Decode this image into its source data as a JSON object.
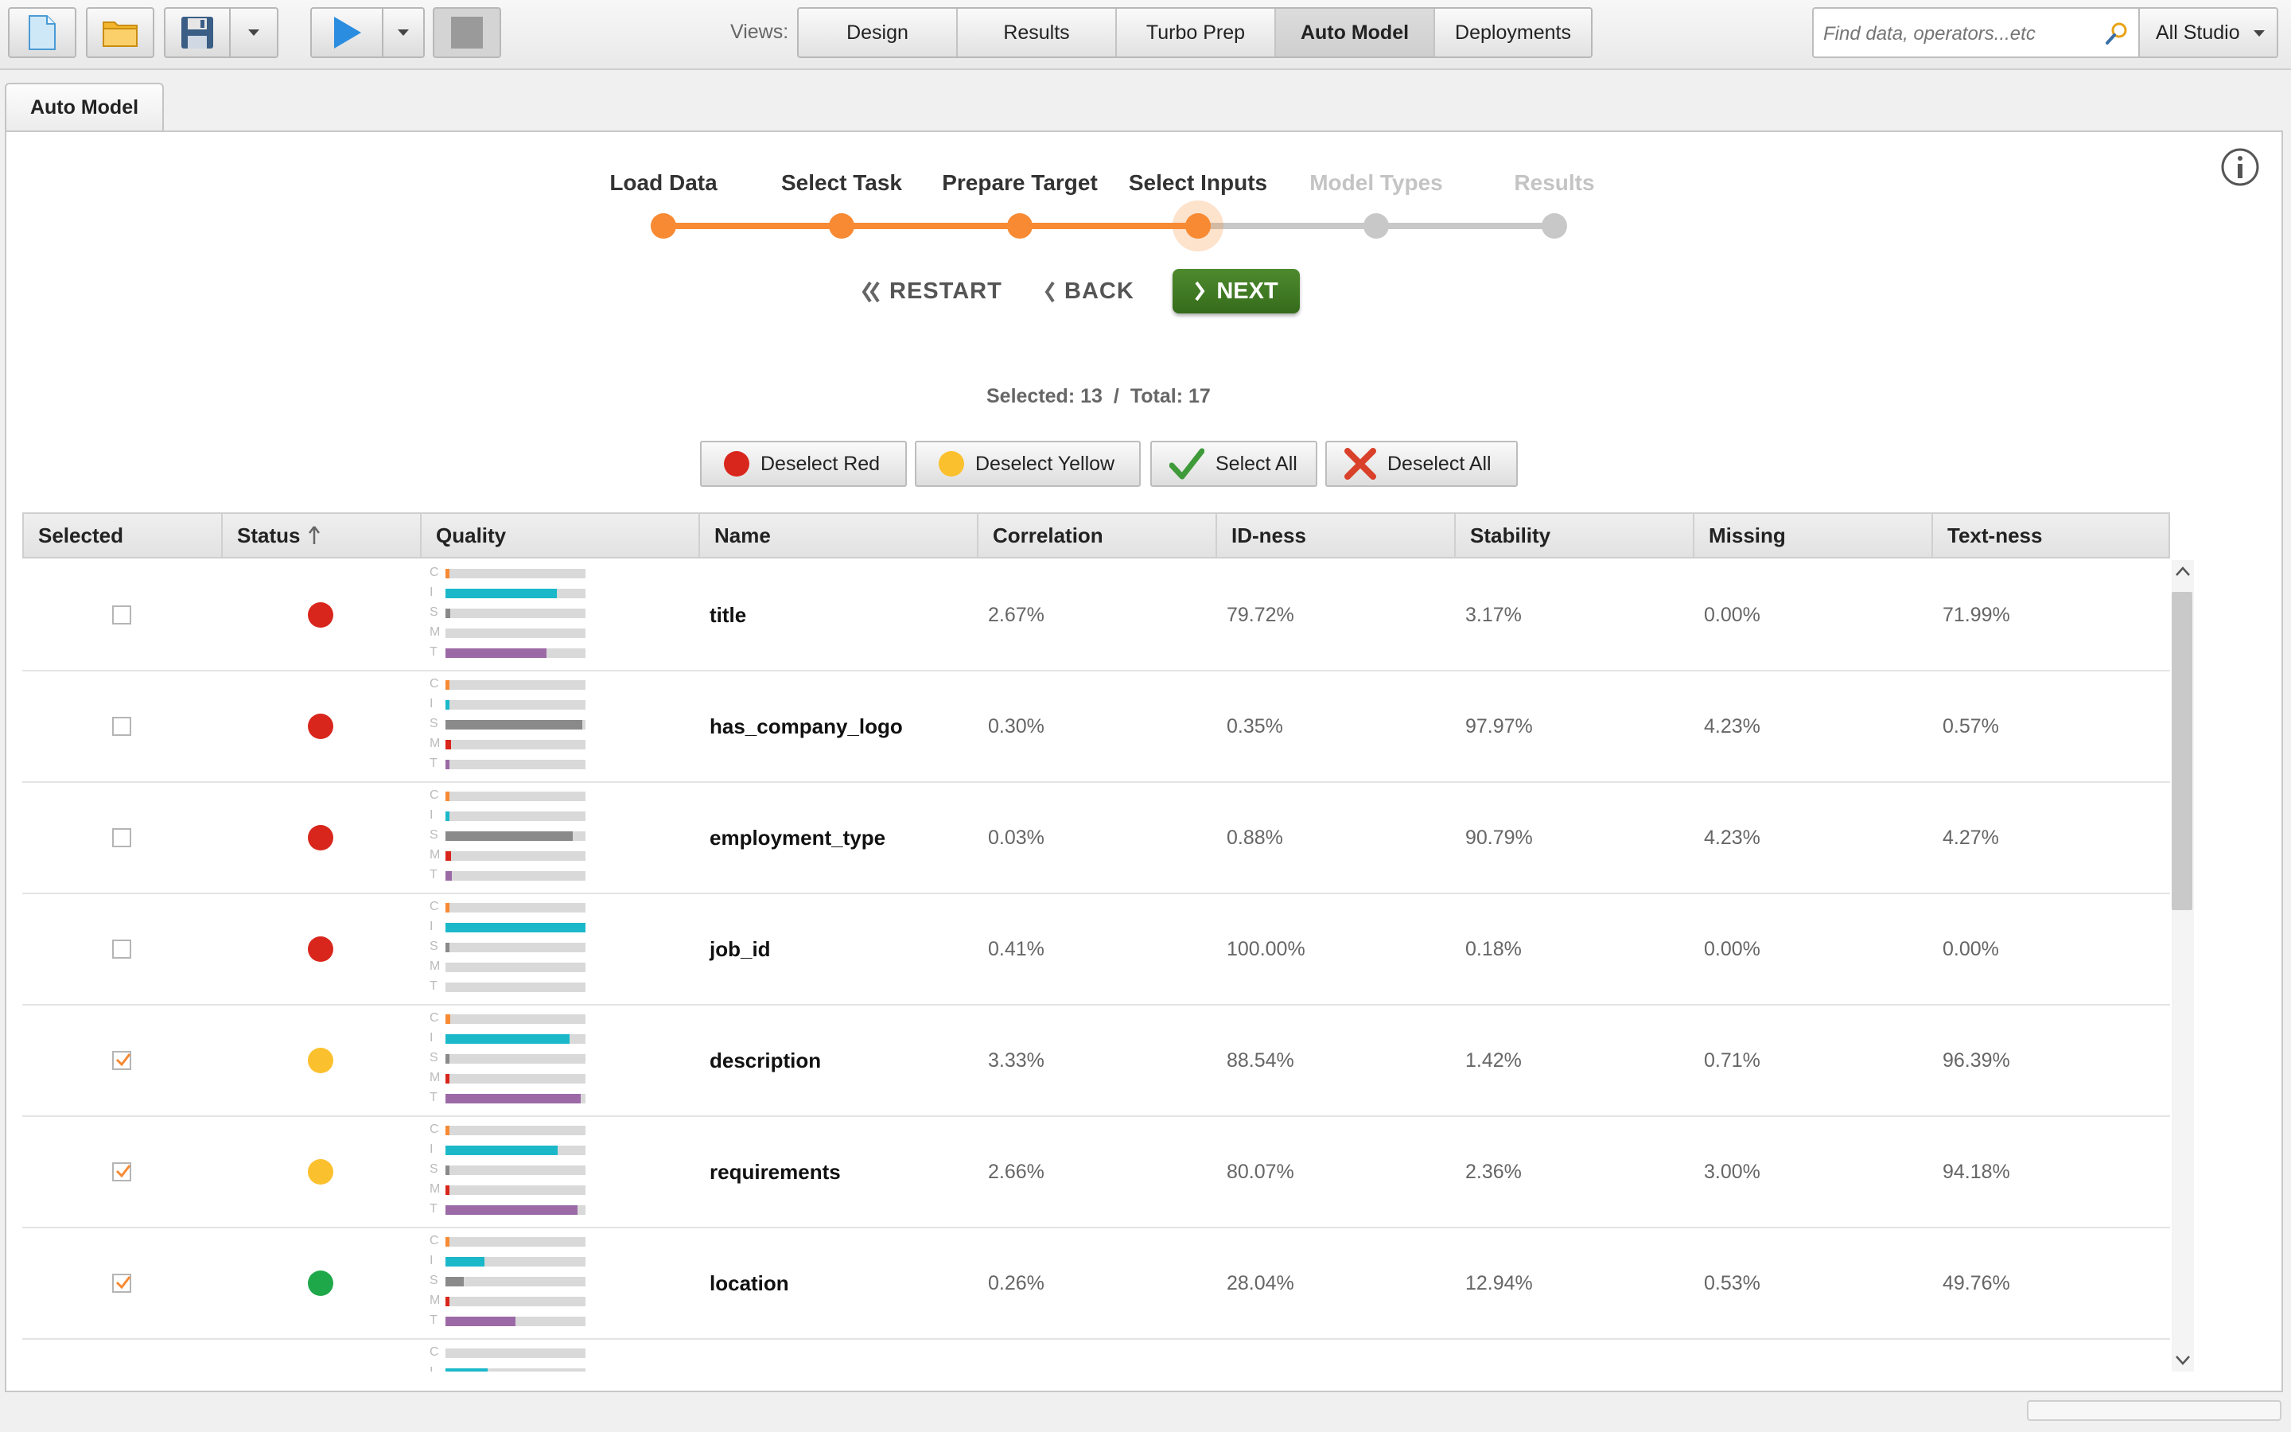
{
  "toolbar": {
    "views_label": "Views:",
    "views": [
      {
        "label": "Design",
        "active": false
      },
      {
        "label": "Results",
        "active": false
      },
      {
        "label": "Turbo Prep",
        "active": false
      },
      {
        "label": "Auto Model",
        "active": true
      },
      {
        "label": "Deployments",
        "active": false
      }
    ],
    "search_placeholder": "Find data, operators...etc",
    "studio_label": "All Studio"
  },
  "pane_tab": "Auto Model",
  "wizard": {
    "steps": [
      {
        "label": "Load Data",
        "state": "done"
      },
      {
        "label": "Select Task",
        "state": "done"
      },
      {
        "label": "Prepare Target",
        "state": "done"
      },
      {
        "label": "Select Inputs",
        "state": "current"
      },
      {
        "label": "Model Types",
        "state": "todo"
      },
      {
        "label": "Results",
        "state": "todo"
      }
    ],
    "restart_label": "RESTART",
    "back_label": "BACK",
    "next_label": "NEXT"
  },
  "counts": {
    "selected": "Selected: 13",
    "separator": "/",
    "total": "Total: 17"
  },
  "buttons": {
    "deselect_red": "Deselect Red",
    "deselect_yellow": "Deselect Yellow",
    "select_all": "Select All",
    "deselect_all": "Deselect All"
  },
  "table": {
    "headers": [
      "Selected",
      "Status",
      "Quality",
      "Name",
      "Correlation",
      "ID-ness",
      "Stability",
      "Missing",
      "Text-ness"
    ],
    "quality_letters": [
      "C",
      "I",
      "S",
      "M",
      "T"
    ],
    "rows": [
      {
        "selected": false,
        "status": "red",
        "name": "title",
        "correlation": "2.67%",
        "idness": "79.72%",
        "stability": "3.17%",
        "missing": "0.00%",
        "textness": "71.99%"
      },
      {
        "selected": false,
        "status": "red",
        "name": "has_company_logo",
        "correlation": "0.30%",
        "idness": "0.35%",
        "stability": "97.97%",
        "missing": "4.23%",
        "textness": "0.57%"
      },
      {
        "selected": false,
        "status": "red",
        "name": "employment_type",
        "correlation": "0.03%",
        "idness": "0.88%",
        "stability": "90.79%",
        "missing": "4.23%",
        "textness": "4.27%"
      },
      {
        "selected": false,
        "status": "red",
        "name": "job_id",
        "correlation": "0.41%",
        "idness": "100.00%",
        "stability": "0.18%",
        "missing": "0.00%",
        "textness": "0.00%"
      },
      {
        "selected": true,
        "status": "yellow",
        "name": "description",
        "correlation": "3.33%",
        "idness": "88.54%",
        "stability": "1.42%",
        "missing": "0.71%",
        "textness": "96.39%"
      },
      {
        "selected": true,
        "status": "yellow",
        "name": "requirements",
        "correlation": "2.66%",
        "idness": "80.07%",
        "stability": "2.36%",
        "missing": "3.00%",
        "textness": "94.18%"
      },
      {
        "selected": true,
        "status": "green",
        "name": "location",
        "correlation": "0.26%",
        "idness": "28.04%",
        "stability": "12.94%",
        "missing": "0.53%",
        "textness": "49.76%"
      },
      {
        "selected": null,
        "status": null,
        "name": "",
        "correlation": "",
        "idness": "",
        "stability": "",
        "missing": "",
        "textness": "",
        "partial": true,
        "partial_quality": {
          "correlation": 0.0,
          "idness": 0.3
        }
      }
    ]
  },
  "colors": {
    "accent": "#f78a33",
    "inactive": "#c8c8c8",
    "status_red": "#d9261c",
    "status_yellow": "#fbc02d",
    "status_green": "#1fa84a",
    "bar_correlation": "#f78a33",
    "bar_idness": "#1ab8c9",
    "bar_stability": "#8a8a8a",
    "bar_missing": "#d9261c",
    "bar_textness": "#9b6aa6",
    "next_button": "#3f7b24"
  }
}
